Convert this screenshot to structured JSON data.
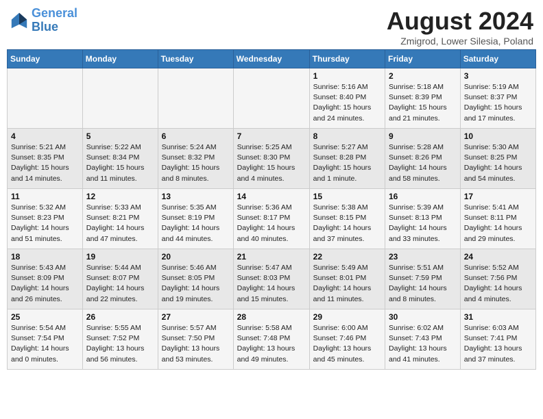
{
  "header": {
    "logo_line1": "General",
    "logo_line2": "Blue",
    "month": "August 2024",
    "location": "Zmigrod, Lower Silesia, Poland"
  },
  "days_of_week": [
    "Sunday",
    "Monday",
    "Tuesday",
    "Wednesday",
    "Thursday",
    "Friday",
    "Saturday"
  ],
  "weeks": [
    [
      {
        "day": "",
        "detail": ""
      },
      {
        "day": "",
        "detail": ""
      },
      {
        "day": "",
        "detail": ""
      },
      {
        "day": "",
        "detail": ""
      },
      {
        "day": "1",
        "detail": "Sunrise: 5:16 AM\nSunset: 8:40 PM\nDaylight: 15 hours\nand 24 minutes."
      },
      {
        "day": "2",
        "detail": "Sunrise: 5:18 AM\nSunset: 8:39 PM\nDaylight: 15 hours\nand 21 minutes."
      },
      {
        "day": "3",
        "detail": "Sunrise: 5:19 AM\nSunset: 8:37 PM\nDaylight: 15 hours\nand 17 minutes."
      }
    ],
    [
      {
        "day": "4",
        "detail": "Sunrise: 5:21 AM\nSunset: 8:35 PM\nDaylight: 15 hours\nand 14 minutes."
      },
      {
        "day": "5",
        "detail": "Sunrise: 5:22 AM\nSunset: 8:34 PM\nDaylight: 15 hours\nand 11 minutes."
      },
      {
        "day": "6",
        "detail": "Sunrise: 5:24 AM\nSunset: 8:32 PM\nDaylight: 15 hours\nand 8 minutes."
      },
      {
        "day": "7",
        "detail": "Sunrise: 5:25 AM\nSunset: 8:30 PM\nDaylight: 15 hours\nand 4 minutes."
      },
      {
        "day": "8",
        "detail": "Sunrise: 5:27 AM\nSunset: 8:28 PM\nDaylight: 15 hours\nand 1 minute."
      },
      {
        "day": "9",
        "detail": "Sunrise: 5:28 AM\nSunset: 8:26 PM\nDaylight: 14 hours\nand 58 minutes."
      },
      {
        "day": "10",
        "detail": "Sunrise: 5:30 AM\nSunset: 8:25 PM\nDaylight: 14 hours\nand 54 minutes."
      }
    ],
    [
      {
        "day": "11",
        "detail": "Sunrise: 5:32 AM\nSunset: 8:23 PM\nDaylight: 14 hours\nand 51 minutes."
      },
      {
        "day": "12",
        "detail": "Sunrise: 5:33 AM\nSunset: 8:21 PM\nDaylight: 14 hours\nand 47 minutes."
      },
      {
        "day": "13",
        "detail": "Sunrise: 5:35 AM\nSunset: 8:19 PM\nDaylight: 14 hours\nand 44 minutes."
      },
      {
        "day": "14",
        "detail": "Sunrise: 5:36 AM\nSunset: 8:17 PM\nDaylight: 14 hours\nand 40 minutes."
      },
      {
        "day": "15",
        "detail": "Sunrise: 5:38 AM\nSunset: 8:15 PM\nDaylight: 14 hours\nand 37 minutes."
      },
      {
        "day": "16",
        "detail": "Sunrise: 5:39 AM\nSunset: 8:13 PM\nDaylight: 14 hours\nand 33 minutes."
      },
      {
        "day": "17",
        "detail": "Sunrise: 5:41 AM\nSunset: 8:11 PM\nDaylight: 14 hours\nand 29 minutes."
      }
    ],
    [
      {
        "day": "18",
        "detail": "Sunrise: 5:43 AM\nSunset: 8:09 PM\nDaylight: 14 hours\nand 26 minutes."
      },
      {
        "day": "19",
        "detail": "Sunrise: 5:44 AM\nSunset: 8:07 PM\nDaylight: 14 hours\nand 22 minutes."
      },
      {
        "day": "20",
        "detail": "Sunrise: 5:46 AM\nSunset: 8:05 PM\nDaylight: 14 hours\nand 19 minutes."
      },
      {
        "day": "21",
        "detail": "Sunrise: 5:47 AM\nSunset: 8:03 PM\nDaylight: 14 hours\nand 15 minutes."
      },
      {
        "day": "22",
        "detail": "Sunrise: 5:49 AM\nSunset: 8:01 PM\nDaylight: 14 hours\nand 11 minutes."
      },
      {
        "day": "23",
        "detail": "Sunrise: 5:51 AM\nSunset: 7:59 PM\nDaylight: 14 hours\nand 8 minutes."
      },
      {
        "day": "24",
        "detail": "Sunrise: 5:52 AM\nSunset: 7:56 PM\nDaylight: 14 hours\nand 4 minutes."
      }
    ],
    [
      {
        "day": "25",
        "detail": "Sunrise: 5:54 AM\nSunset: 7:54 PM\nDaylight: 14 hours\nand 0 minutes."
      },
      {
        "day": "26",
        "detail": "Sunrise: 5:55 AM\nSunset: 7:52 PM\nDaylight: 13 hours\nand 56 minutes."
      },
      {
        "day": "27",
        "detail": "Sunrise: 5:57 AM\nSunset: 7:50 PM\nDaylight: 13 hours\nand 53 minutes."
      },
      {
        "day": "28",
        "detail": "Sunrise: 5:58 AM\nSunset: 7:48 PM\nDaylight: 13 hours\nand 49 minutes."
      },
      {
        "day": "29",
        "detail": "Sunrise: 6:00 AM\nSunset: 7:46 PM\nDaylight: 13 hours\nand 45 minutes."
      },
      {
        "day": "30",
        "detail": "Sunrise: 6:02 AM\nSunset: 7:43 PM\nDaylight: 13 hours\nand 41 minutes."
      },
      {
        "day": "31",
        "detail": "Sunrise: 6:03 AM\nSunset: 7:41 PM\nDaylight: 13 hours\nand 37 minutes."
      }
    ]
  ]
}
